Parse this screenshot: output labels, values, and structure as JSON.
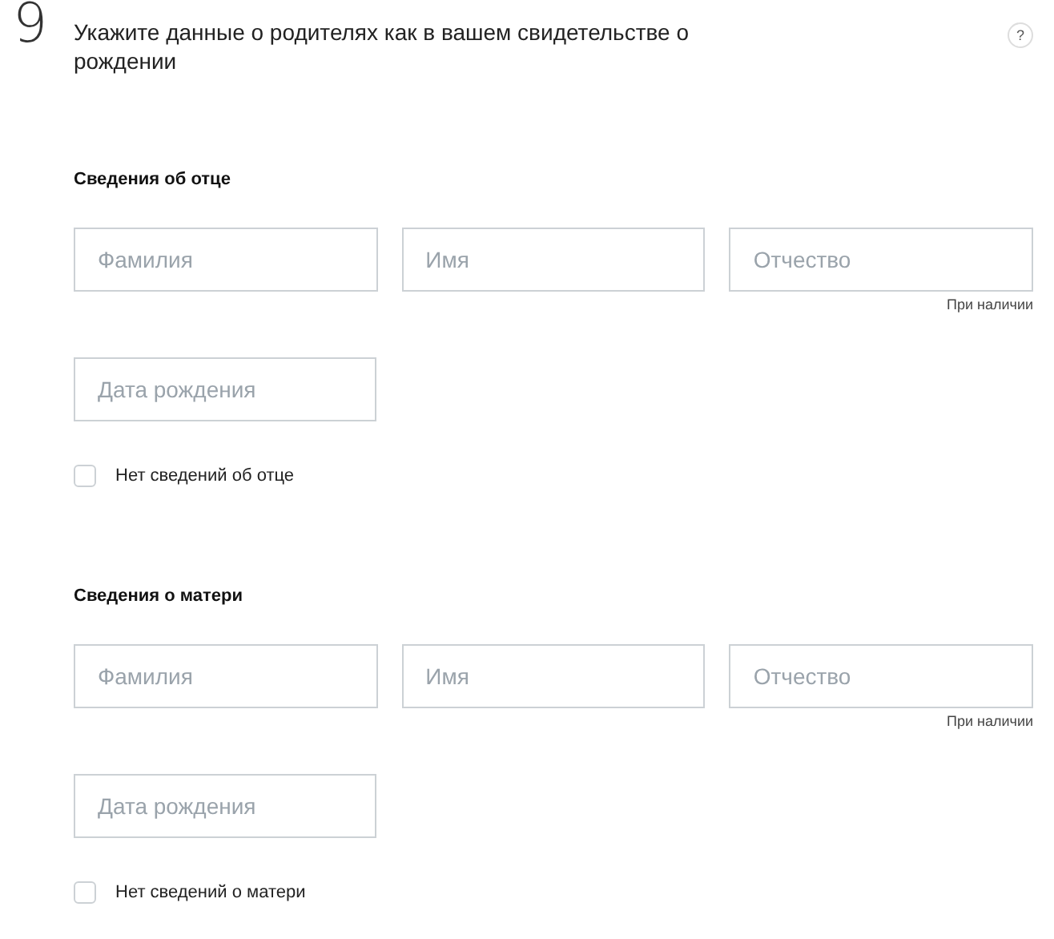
{
  "step_number": "9",
  "title": "Укажите данные о родителях как в вашем свидетельстве о рождении",
  "help": "?",
  "sections": [
    {
      "heading": "Сведения об отце",
      "fields": [
        {
          "placeholder": "Фамилия"
        },
        {
          "placeholder": "Имя"
        },
        {
          "placeholder": "Отчество",
          "hint": "При наличии"
        }
      ],
      "date_field": {
        "placeholder": "Дата рождения"
      },
      "no_info": {
        "label": "Нет сведений об отце",
        "checked": false
      }
    },
    {
      "heading": "Сведения о матери",
      "fields": [
        {
          "placeholder": "Фамилия"
        },
        {
          "placeholder": "Имя"
        },
        {
          "placeholder": "Отчество",
          "hint": "При наличии"
        }
      ],
      "date_field": {
        "placeholder": "Дата рождения"
      },
      "no_info": {
        "label": "Нет сведений о матери",
        "checked": false
      }
    }
  ]
}
